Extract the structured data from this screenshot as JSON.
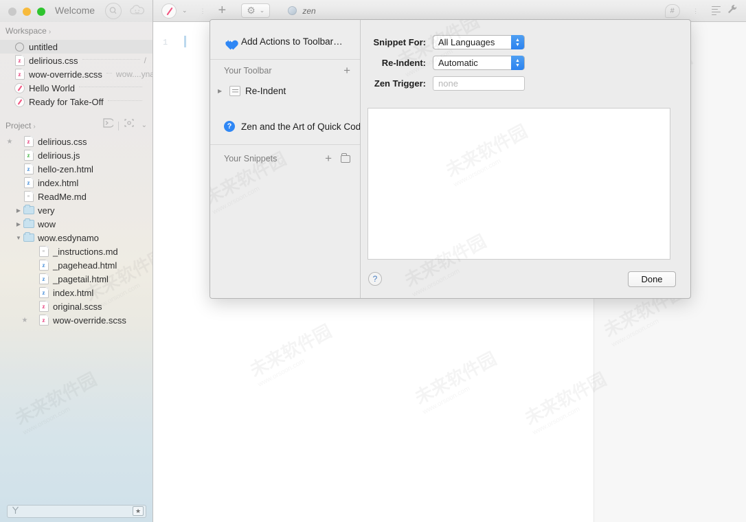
{
  "window": {
    "title": "Welcome",
    "traffic_lights": [
      "close",
      "minimize",
      "zoom"
    ],
    "search_icon": "search-icon",
    "face_icon": "smiley-cloud-icon"
  },
  "sidebar": {
    "workspace": {
      "label": "Workspace",
      "chevron": "›",
      "items": [
        {
          "name": "untitled",
          "icon": "circle-outline-icon",
          "meta": "",
          "selected": true
        },
        {
          "name": "delirious.css",
          "icon": "scss-file-icon",
          "meta": "/",
          "selected": false
        },
        {
          "name": "wow-override.scss",
          "icon": "scss-file-icon",
          "meta": "wow....ynamo",
          "selected": false
        },
        {
          "name": "Hello World",
          "icon": "compass-icon",
          "meta": "",
          "selected": false
        },
        {
          "name": "Ready for Take-Off",
          "icon": "compass-icon",
          "meta": "",
          "selected": false
        }
      ]
    },
    "project": {
      "label": "Project",
      "chevron": "›",
      "console_icon": "console-icon",
      "settings_icon": "settings-brackets-icon",
      "settings_chevron": "⌄",
      "items": [
        {
          "name": "delirious.css",
          "icon": "scss-file-icon",
          "indent": 0,
          "star": true,
          "disc": ""
        },
        {
          "name": "delirious.js",
          "icon": "js-file-icon",
          "indent": 0,
          "star": false,
          "disc": ""
        },
        {
          "name": "hello-zen.html",
          "icon": "html-file-icon",
          "indent": 0,
          "star": false,
          "disc": ""
        },
        {
          "name": "index.html",
          "icon": "html-file-icon",
          "indent": 0,
          "star": false,
          "disc": ""
        },
        {
          "name": "ReadMe.md",
          "icon": "md-file-icon",
          "indent": 0,
          "star": false,
          "disc": ""
        },
        {
          "name": "very",
          "icon": "folder-icon",
          "indent": 0,
          "star": false,
          "disc": "▶"
        },
        {
          "name": "wow",
          "icon": "folder-icon",
          "indent": 0,
          "star": false,
          "disc": "▶"
        },
        {
          "name": "wow.esdynamo",
          "icon": "folder-icon",
          "indent": 0,
          "star": false,
          "disc": "▼"
        },
        {
          "name": "_instructions.md",
          "icon": "md-file-icon",
          "indent": 1,
          "star": false,
          "disc": ""
        },
        {
          "name": "_pagehead.html",
          "icon": "html-file-icon",
          "indent": 1,
          "star": false,
          "disc": ""
        },
        {
          "name": "_pagetail.html",
          "icon": "html-file-icon",
          "indent": 1,
          "star": false,
          "disc": ""
        },
        {
          "name": "index.html",
          "icon": "html-file-icon",
          "indent": 1,
          "star": false,
          "disc": ""
        },
        {
          "name": "original.scss",
          "icon": "scss-file-icon",
          "indent": 1,
          "star": false,
          "disc": ""
        },
        {
          "name": "wow-override.scss",
          "icon": "scss-file-icon",
          "indent": 1,
          "star": true,
          "disc": ""
        }
      ]
    },
    "footer": {
      "filter_placeholder": "",
      "filter_icon": "branch-filter-icon",
      "star_button": "★"
    }
  },
  "toolbar": {
    "compass_icon": "compass-icon",
    "compass_chevron": "⌄",
    "overflow_dots": "⋮",
    "plus_label": "+",
    "gear_icon": "⚙",
    "gear_chevron": "⌄",
    "document_icon": "globe-icon",
    "document_name": "zen",
    "hash_bubble": "#",
    "right_dots": "⋮",
    "lines_icon": "lines-icon",
    "wrench_icon": "🔧"
  },
  "editor": {
    "line_number": "1",
    "content": ""
  },
  "dialog": {
    "header_item": {
      "label": "Add Actions to Toolbar…",
      "icon": "heart-icon"
    },
    "toolbar_section": {
      "label": "Your Toolbar",
      "add_label": "+",
      "items": [
        {
          "label": "Re-Indent",
          "disclosure": "▶",
          "icon": "action-doc-icon"
        }
      ]
    },
    "help_item": {
      "label": "Zen and the Art of Quick Codin",
      "icon": "question-icon"
    },
    "snippets_section": {
      "label": "Your Snippets",
      "add_label": "+",
      "folder_icon": "folder-icon",
      "items": []
    },
    "form": {
      "fields": [
        {
          "label": "Snippet For:",
          "value": "All Languages",
          "type": "select"
        },
        {
          "label": "Re-Indent:",
          "value": "Automatic",
          "type": "select"
        },
        {
          "label": "Zen Trigger:",
          "value": "",
          "placeholder": "none",
          "type": "text"
        }
      ],
      "snippet_body": ""
    },
    "help_button": "?",
    "done_button": "Done"
  },
  "colors": {
    "accent_blue": "#2f87f5",
    "stepper_blue": "#2b82ef",
    "scss_pink": "#e8447f",
    "js_green": "#49b749",
    "html_blue": "#4a90d9",
    "selection_gray": "#e1e1e1",
    "traffic_yellow": "#f7ba3c",
    "traffic_green": "#2fc42f"
  },
  "watermark": {
    "text": "未来软件园",
    "sub": "www.orsoon.com"
  }
}
